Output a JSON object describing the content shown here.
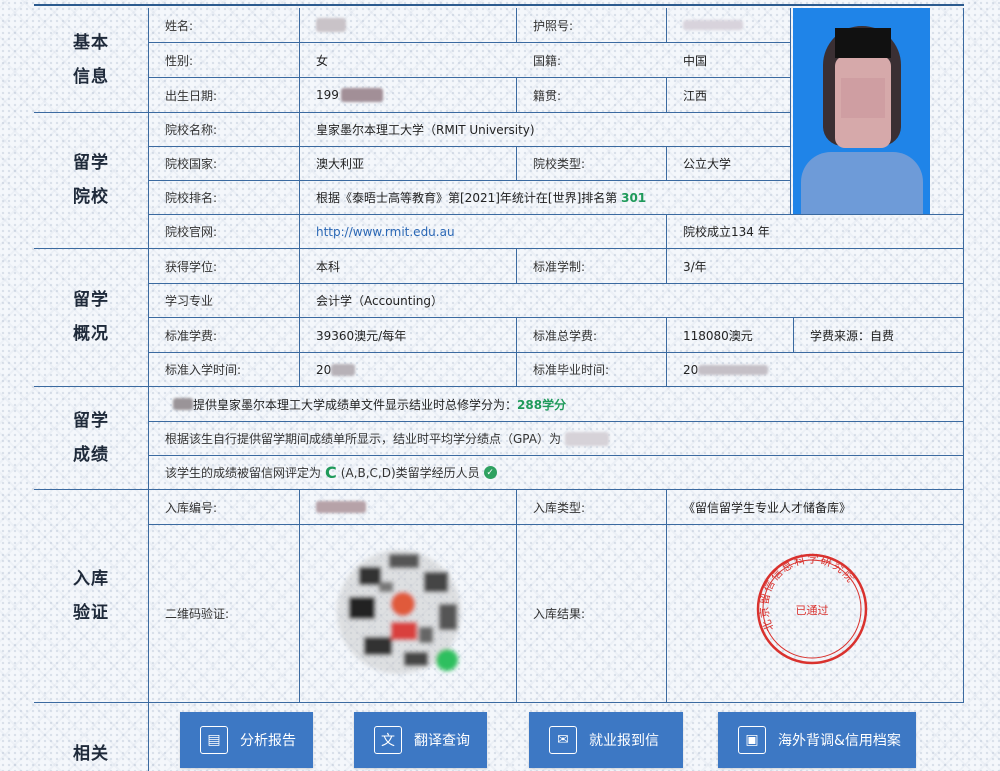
{
  "sections": {
    "basic": [
      "基本",
      "信息"
    ],
    "school": [
      "留学",
      "院校"
    ],
    "overview": [
      "留学",
      "概况"
    ],
    "grades": [
      "留学",
      "成绩"
    ],
    "verify": [
      "入库",
      "验证"
    ],
    "related": [
      "相关"
    ]
  },
  "basic": {
    "name_label": "姓名:",
    "passport_label": "护照号:",
    "gender_label": "性别:",
    "gender": "女",
    "nationality_label": "国籍:",
    "nationality": "中国",
    "birth_label": "出生日期:",
    "birth": "199",
    "origin_label": "籍贯:",
    "origin": "江西"
  },
  "school": {
    "name_label": "院校名称:",
    "name": "皇家墨尔本理工大学（RMIT University)",
    "country_label": "院校国家:",
    "country": "澳大利亚",
    "type_label": "院校类型:",
    "type": "公立大学",
    "rank_label": "院校排名:",
    "rank_text": "根据《泰晤士高等教育》第[2021]年统计在[世界]排名第",
    "rank_value": "301",
    "site_label": "院校官网:",
    "site": "http://www.rmit.edu.au",
    "founded": "院校成立134 年"
  },
  "overview": {
    "degree_label": "获得学位:",
    "degree": "本科",
    "duration_label": "标准学制:",
    "duration": "3/年",
    "major_label": "学习专业",
    "major": "会计学（Accounting）",
    "fee_label": "标准学费:",
    "fee": "39360澳元/每年",
    "total_fee_label": "标准总学费:",
    "total_fee": "118080澳元",
    "fee_source": "学费来源：自费",
    "enroll_label": "标准入学时间:",
    "enroll": "20",
    "grad_label": "标准毕业时间:",
    "grad": "20"
  },
  "grades": {
    "line1": "提供皇家墨尔本理工大学成绩单文件显示结业时总修学分为：",
    "credits": "288学分",
    "line2": "根据该生自行提供留学期间成绩单所显示，结业时平均学分绩点（GPA）为",
    "line3_pre": "该学生的成绩被留信网评定为",
    "grade": "C",
    "line3_post": "(A,B,C,D)类留学经历人员"
  },
  "verify": {
    "no_label": "入库编号:",
    "type_label": "入库类型:",
    "type": "《留信留学生专业人才储备库》",
    "qr_label": "二维码验证:",
    "result_label": "入库结果:",
    "seal_center": "已通过",
    "seal_ring": "北京留信信息科学研究院"
  },
  "buttons": [
    {
      "label": "分析报告",
      "icon": "chart-report-icon"
    },
    {
      "label": "翻译查询",
      "icon": "translate-icon"
    },
    {
      "label": "就业报到信",
      "icon": "envelope-icon"
    },
    {
      "label": "海外背调&信用档案",
      "icon": "archive-icon"
    }
  ],
  "colors": {
    "border": "#3b6aa0",
    "accent_green": "#1f9a5a",
    "button": "#3d78c4",
    "seal": "#d9322e",
    "photo_bg": "#1f84e8"
  }
}
